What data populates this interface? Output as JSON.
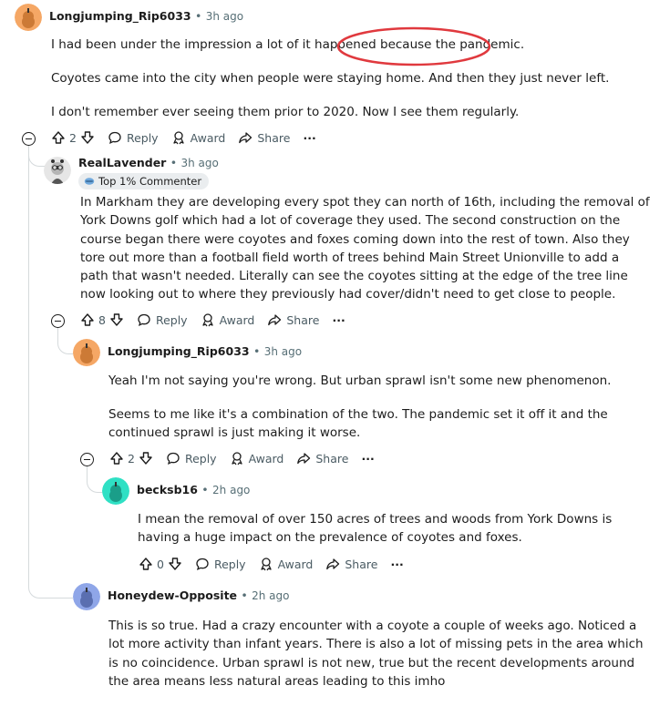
{
  "comments": [
    {
      "username": "Longjumping_Rip6033",
      "time": "3h ago",
      "paragraphs": [
        "I had been under the impression a lot of it happened because the pandemic.",
        "Coyotes came into the city when people were staying home. And then they just never left.",
        "I don't remember ever seeing them prior to 2020. Now I see them regularly."
      ],
      "votes": "2"
    },
    {
      "username": "RealLavender",
      "time": "3h ago",
      "badge": "Top 1% Commenter",
      "paragraphs": [
        "In Markham they are developing every spot they can north of 16th, including the removal of York Downs golf which had a lot of coverage they used. The second construction on the course began there were coyotes and foxes coming down into the rest of town. Also they tore out more than a football field worth of trees behind Main Street Unionville to add a path that wasn't needed. Literally can see the coyotes sitting at the edge of the tree line now looking out to where they previously had cover/didn't need to get close to people."
      ],
      "votes": "8"
    },
    {
      "username": "Longjumping_Rip6033",
      "time": "3h ago",
      "paragraphs": [
        "Yeah I'm not saying you're wrong. But urban sprawl isn't some new phenomenon.",
        "Seems to me like it's a combination of the two. The pandemic set it off it and the continued sprawl is just making it worse."
      ],
      "votes": "2"
    },
    {
      "username": "becksb16",
      "time": "2h ago",
      "paragraphs": [
        "I mean the removal of over 150 acres of trees and woods from York Downs is having a huge impact on the prevalence of coyotes and foxes."
      ],
      "votes": "0"
    },
    {
      "username": "Honeydew-Opposite",
      "time": "2h ago",
      "paragraphs": [
        "This is so true. Had a crazy encounter with a coyote a couple of weeks ago. Noticed a lot more activity than infant years. There is also a lot of missing pets in the area which is no coincidence. Urban sprawl is not new, true but the recent developments around the area means less natural areas leading to this imho"
      ]
    }
  ],
  "actions": {
    "reply": "Reply",
    "award": "Award",
    "share": "Share",
    "more": "···",
    "separator": "•"
  },
  "colors": {
    "avatar_orange": "#f5a765",
    "avatar_teal": "#2fe0c4",
    "avatar_periwinkle": "#8fa6e8",
    "highlight_circle": "#e0393e",
    "thread_line": "#d5dadc"
  }
}
